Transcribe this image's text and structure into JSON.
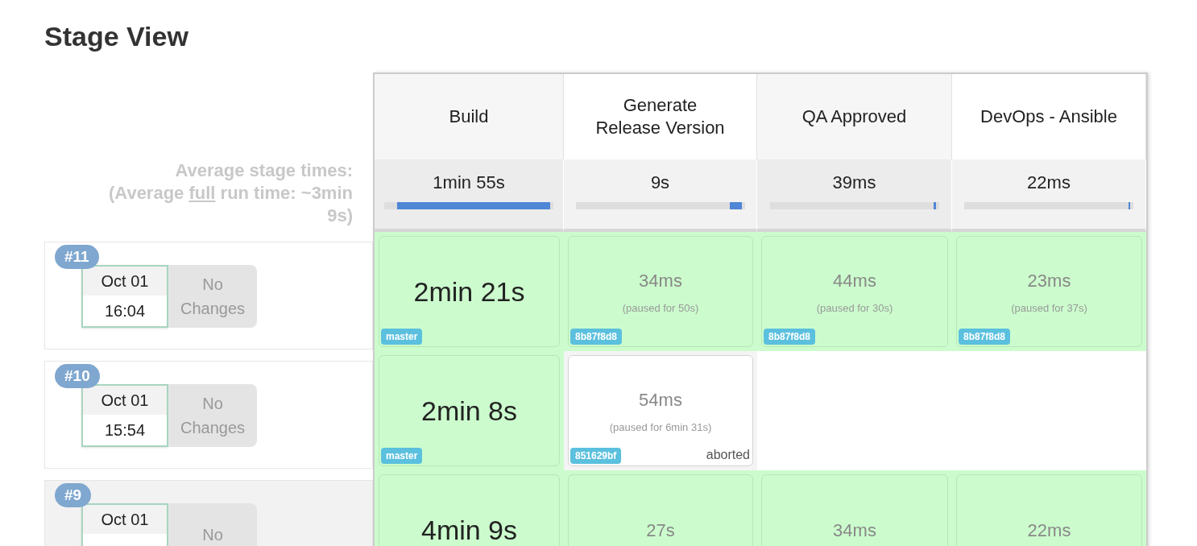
{
  "title": "Stage View",
  "averages": {
    "heading": "Average stage times:",
    "full_prefix": "(Average ",
    "full_link": "full",
    "full_suffix": " run time: ~3min 9s)"
  },
  "stages": [
    {
      "name": "Build",
      "average": "1min 55s",
      "level": 0.92
    },
    {
      "name": "Generate Release Version",
      "average": "9s",
      "level": 0.07
    },
    {
      "name": "QA Approved",
      "average": "39ms",
      "level": 0.01
    },
    {
      "name": "DevOps - Ansible",
      "average": "22ms",
      "level": 0.01
    }
  ],
  "builds": [
    {
      "number": "#11",
      "date": "Oct 01",
      "time": "16:04",
      "changes": "No Changes",
      "cells": [
        {
          "kind": "success",
          "duration": "2min 21s",
          "tag": "master"
        },
        {
          "kind": "success",
          "duration": "34ms",
          "paused": "(paused for 50s)",
          "tag": "8b87f8d8"
        },
        {
          "kind": "success",
          "duration": "44ms",
          "paused": "(paused for 30s)",
          "tag": "8b87f8d8"
        },
        {
          "kind": "success",
          "duration": "23ms",
          "paused": "(paused for 37s)",
          "tag": "8b87f8d8"
        }
      ]
    },
    {
      "number": "#10",
      "date": "Oct 01",
      "time": "15:54",
      "changes": "No Changes",
      "cells": [
        {
          "kind": "success",
          "duration": "2min 8s",
          "tag": "master"
        },
        {
          "kind": "aborted",
          "duration": "54ms",
          "paused": "(paused for 6min 31s)",
          "tag": "851629bf",
          "status": "aborted"
        },
        {
          "kind": "empty"
        },
        {
          "kind": "empty"
        }
      ]
    },
    {
      "number": "#9",
      "date": "Oct 01",
      "changes": "No",
      "cells": [
        {
          "kind": "success",
          "duration": "4min 9s"
        },
        {
          "kind": "success",
          "duration": "27s"
        },
        {
          "kind": "success",
          "duration": "34ms"
        },
        {
          "kind": "success",
          "duration": "22ms"
        }
      ]
    }
  ]
}
